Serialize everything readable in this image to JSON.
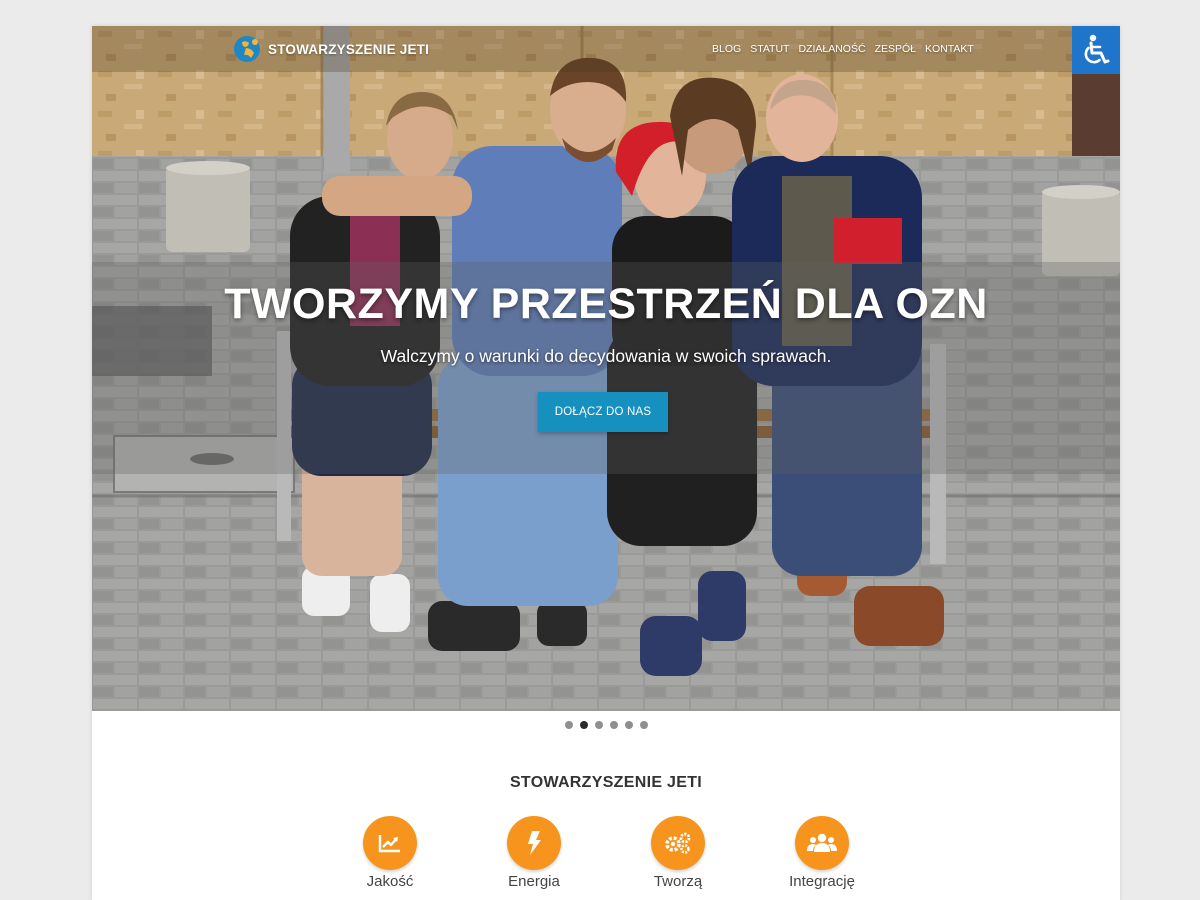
{
  "header": {
    "brand": "STOWARZYSZENIE JETI",
    "logo_icon": "jeti-logo-icon",
    "nav": [
      {
        "label": "BLOG"
      },
      {
        "label": "STATUT"
      },
      {
        "label": "DZIAŁANOŚĆ"
      },
      {
        "label": "ZESPÓŁ"
      },
      {
        "label": "KONTAKT"
      }
    ],
    "accessibility_icon": "wheelchair-icon"
  },
  "hero": {
    "title": "TWORZYMY PRZESTRZEŃ DLA OZN",
    "subtitle": "Walczymy o warunki do decydowania w swoich sprawach.",
    "cta_label": "DOŁĄCZ DO NAS",
    "slides_count": 6,
    "active_slide": 2
  },
  "about": {
    "title": "STOWARZYSZENIE JETI",
    "features": [
      {
        "label": "Jakość",
        "icon": "chart-icon"
      },
      {
        "label": "Energia",
        "icon": "lightning-icon"
      },
      {
        "label": "Tworzą",
        "icon": "gears-icon"
      },
      {
        "label": "Integrację",
        "icon": "users-icon"
      }
    ]
  },
  "colors": {
    "accent_orange": "#f7941d",
    "cta_blue": "#1590bf",
    "a11y_blue": "#1e75c9"
  }
}
